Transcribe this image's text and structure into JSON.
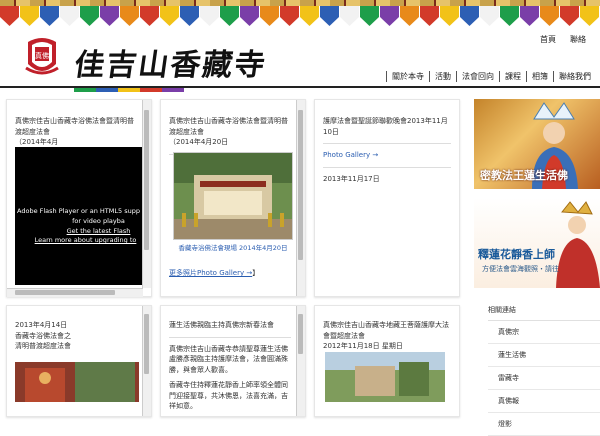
{
  "header": {
    "site_title": "佳吉山香藏寺",
    "seal_text": "真佛",
    "top_links": [
      "首頁",
      "聯絡"
    ],
    "nav_items": [
      "關於本寺",
      "活動",
      "法會回向",
      "課程",
      "相簿",
      "聯絡我們"
    ]
  },
  "banner_colors": [
    "#d23a2a",
    "#f2c218",
    "#2d5fb4",
    "#f2f2f2",
    "#1e9e4a",
    "#7a3ea8",
    "#e88a1a"
  ],
  "strip_colors": [
    "#1e9e4a",
    "#2d5fb4",
    "#f2c218",
    "#d23a2a",
    "#7a3ea8"
  ],
  "posts": [
    {
      "title": "真佛宗佳吉山香藏寺浴佛法會暨清明普渡超度法會",
      "date_line": "（2014年4月",
      "flash": {
        "line1": "Adobe Flash Player or an HTML5 supp",
        "line2": "for video playba",
        "link1": "Get the latest Flash",
        "link2": "Learn more about upgrading to"
      }
    },
    {
      "title": "真佛宗佳吉山香藏寺浴佛法會暨清明普渡超度法會",
      "date_line": "（2014年4月20日",
      "photo_caption": "香藏寺浴佛法會現場 2014年4月20日",
      "link_prefix": "更多照片",
      "link_text": "Photo Gallery →",
      "link_suffix": "】"
    },
    {
      "title": "護摩法會暨聖誕節聯歡晚會2013年11月10日",
      "link_text": "Photo Gallery →",
      "date": "2013年11月17日"
    },
    {
      "date": "2013年4月14日",
      "line1": "香藏寺浴佛法會之",
      "line2": "清明普渡超度法會"
    },
    {
      "title": "蓮生活佛親臨主持真佛宗新春法會",
      "para1": "真佛宗佳吉山香藏寺恭請聖尊蓮生活佛盧勝彥親臨主持護摩法會，法會圓滿殊勝，與會眾人歡喜。",
      "para2": "香藏寺住持釋蓮花靜香上師率領全體同門迎接聖尊，共沐佛恩，法喜充滿，吉祥如意。"
    },
    {
      "title": "真佛宗佳吉山香藏寺地藏王菩薩護摩大法會暨超度法會",
      "date_line": "2012年11月18日 星期日"
    }
  ],
  "promo1": {
    "text": "密教法王蓮生活佛"
  },
  "promo2": {
    "text": "釋蓮花靜香上師",
    "sub": "方便法會雲海觀照・請往"
  },
  "side_menu": {
    "heading": "相關連結",
    "items": [
      "真佛宗",
      "蓮生活佛",
      "雷藏寺",
      "真佛報",
      "燈影"
    ]
  }
}
